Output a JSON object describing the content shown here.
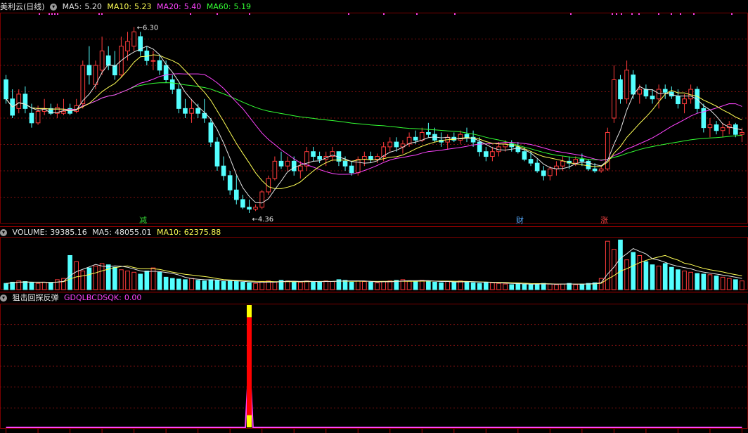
{
  "panel_price": {
    "title": "美利云(日线)",
    "legend": [
      {
        "label": "MA5:",
        "value": "5.20",
        "color": "#e6e6e6"
      },
      {
        "label": "MA10:",
        "value": "5.23",
        "color": "#ffff55"
      },
      {
        "label": "MA20:",
        "value": "5.40",
        "color": "#ff44ff"
      },
      {
        "label": "MA60:",
        "value": "5.19",
        "color": "#33ff33"
      }
    ],
    "high_label": "6.30",
    "low_label": "4.36",
    "markers": [
      {
        "text": "减",
        "color": "#33cc33"
      },
      {
        "text": "财",
        "color": "#55aaff"
      },
      {
        "text": "涨",
        "color": "#ff4444"
      }
    ]
  },
  "panel_volume": {
    "title": "VOLUME:",
    "title_value": "39385.16",
    "legend": [
      {
        "label": "MA5:",
        "value": "48055.01",
        "color": "#e6e6e6"
      },
      {
        "label": "MA10:",
        "value": "62375.88",
        "color": "#ffff55"
      }
    ]
  },
  "panel_indicator": {
    "title": "狙击回探反弹",
    "legend": [
      {
        "label": "GDQLBCDSQK:",
        "value": "0.00",
        "color": "#ff44ff"
      }
    ]
  },
  "colors": {
    "up": "#ff3b3b",
    "down": "#54ffff",
    "ma5": "#e6e6e6",
    "ma10": "#ffff55",
    "ma20": "#ff44ff",
    "ma60": "#33ff33",
    "grid": "#7a1010"
  },
  "chart_data": [
    {
      "type": "candlestick",
      "series": [
        {
          "name": "OHLC",
          "values": [
            [
              5.75,
              5.8,
              5.5,
              5.55
            ],
            [
              5.55,
              5.65,
              5.35,
              5.38
            ],
            [
              5.45,
              5.65,
              5.4,
              5.6
            ],
            [
              5.6,
              5.68,
              5.4,
              5.45
            ],
            [
              5.4,
              5.5,
              5.25,
              5.3
            ],
            [
              5.3,
              5.48,
              5.28,
              5.42
            ],
            [
              5.42,
              5.55,
              5.38,
              5.45
            ],
            [
              5.45,
              5.5,
              5.38,
              5.4
            ],
            [
              5.4,
              5.5,
              5.35,
              5.46
            ],
            [
              5.4,
              5.55,
              5.38,
              5.42
            ],
            [
              5.45,
              5.5,
              5.38,
              5.4
            ],
            [
              5.42,
              5.55,
              5.4,
              5.48
            ],
            [
              5.5,
              5.95,
              5.45,
              5.9
            ],
            [
              5.9,
              6.1,
              5.7,
              5.8
            ],
            [
              5.7,
              5.95,
              5.65,
              5.9
            ],
            [
              5.85,
              6.2,
              5.8,
              6.05
            ],
            [
              6.0,
              6.1,
              5.85,
              5.9
            ],
            [
              5.9,
              6.05,
              5.75,
              5.8
            ],
            [
              5.8,
              6.2,
              5.78,
              6.1
            ],
            [
              6.05,
              6.25,
              5.95,
              6.15
            ],
            [
              6.1,
              6.3,
              6.05,
              6.25
            ],
            [
              6.2,
              6.25,
              6.0,
              6.05
            ],
            [
              6.05,
              6.1,
              5.9,
              5.95
            ],
            [
              5.95,
              6.05,
              5.85,
              5.95
            ],
            [
              5.95,
              6.0,
              5.8,
              5.85
            ],
            [
              5.9,
              5.95,
              5.72,
              5.75
            ],
            [
              5.75,
              5.8,
              5.6,
              5.65
            ],
            [
              5.65,
              5.7,
              5.4,
              5.45
            ],
            [
              5.45,
              5.55,
              5.35,
              5.4
            ],
            [
              5.4,
              5.55,
              5.3,
              5.45
            ],
            [
              5.45,
              5.5,
              5.35,
              5.4
            ],
            [
              5.4,
              5.55,
              5.3,
              5.35
            ],
            [
              5.3,
              5.35,
              5.05,
              5.1
            ],
            [
              5.1,
              5.15,
              4.8,
              4.85
            ],
            [
              4.85,
              4.95,
              4.7,
              4.75
            ],
            [
              4.75,
              4.8,
              4.55,
              4.6
            ],
            [
              4.6,
              4.75,
              4.45,
              4.5
            ],
            [
              4.5,
              4.55,
              4.4,
              4.42
            ],
            [
              4.42,
              4.5,
              4.36,
              4.4
            ],
            [
              4.4,
              4.45,
              4.38,
              4.42
            ],
            [
              4.42,
              4.6,
              4.4,
              4.58
            ],
            [
              4.58,
              4.75,
              4.55,
              4.72
            ],
            [
              4.72,
              4.95,
              4.7,
              4.9
            ],
            [
              4.9,
              5.0,
              4.82,
              4.85
            ],
            [
              4.85,
              4.95,
              4.8,
              4.9
            ],
            [
              4.9,
              4.95,
              4.75,
              4.8
            ],
            [
              4.8,
              4.9,
              4.72,
              4.85
            ],
            [
              4.85,
              5.05,
              4.8,
              5.0
            ],
            [
              5.0,
              5.05,
              4.9,
              4.95
            ],
            [
              4.95,
              5.0,
              4.88,
              4.92
            ],
            [
              4.92,
              5.0,
              4.85,
              4.95
            ],
            [
              4.95,
              5.05,
              4.9,
              5.0
            ],
            [
              5.0,
              5.0,
              4.85,
              4.9
            ],
            [
              4.9,
              4.95,
              4.8,
              4.85
            ],
            [
              4.85,
              4.9,
              4.75,
              4.78
            ],
            [
              4.78,
              4.95,
              4.75,
              4.92
            ],
            [
              4.92,
              5.0,
              4.85,
              4.95
            ],
            [
              4.95,
              5.0,
              4.88,
              4.92
            ],
            [
              4.92,
              4.98,
              4.88,
              4.95
            ],
            [
              4.95,
              5.1,
              4.9,
              5.05
            ],
            [
              5.05,
              5.15,
              5.0,
              5.1
            ],
            [
              5.1,
              5.15,
              5.0,
              5.05
            ],
            [
              5.05,
              5.12,
              4.98,
              5.08
            ],
            [
              5.08,
              5.2,
              5.05,
              5.15
            ],
            [
              5.15,
              5.22,
              5.08,
              5.12
            ],
            [
              5.12,
              5.25,
              5.1,
              5.2
            ],
            [
              5.2,
              5.3,
              5.15,
              5.18
            ],
            [
              5.18,
              5.25,
              5.1,
              5.12
            ],
            [
              5.12,
              5.2,
              5.05,
              5.1
            ],
            [
              5.1,
              5.18,
              5.02,
              5.15
            ],
            [
              5.15,
              5.2,
              5.1,
              5.12
            ],
            [
              5.12,
              5.22,
              5.08,
              5.18
            ],
            [
              5.18,
              5.25,
              5.1,
              5.15
            ],
            [
              5.15,
              5.22,
              5.05,
              5.1
            ],
            [
              5.1,
              5.15,
              4.95,
              5.0
            ],
            [
              5.0,
              5.05,
              4.9,
              4.95
            ],
            [
              4.95,
              5.05,
              4.9,
              5.0
            ],
            [
              5.0,
              5.1,
              4.95,
              5.05
            ],
            [
              5.05,
              5.12,
              5.0,
              5.08
            ],
            [
              5.08,
              5.12,
              5.0,
              5.05
            ],
            [
              5.05,
              5.1,
              4.98,
              5.0
            ],
            [
              5.0,
              5.05,
              4.9,
              4.92
            ],
            [
              4.92,
              5.0,
              4.85,
              4.88
            ],
            [
              4.88,
              4.92,
              4.78,
              4.8
            ],
            [
              4.8,
              4.85,
              4.7,
              4.75
            ],
            [
              4.75,
              4.85,
              4.7,
              4.82
            ],
            [
              4.82,
              4.9,
              4.75,
              4.85
            ],
            [
              4.85,
              4.95,
              4.8,
              4.9
            ],
            [
              4.9,
              4.95,
              4.82,
              4.88
            ],
            [
              4.88,
              4.95,
              4.85,
              4.92
            ],
            [
              4.92,
              4.98,
              4.85,
              4.9
            ],
            [
              4.9,
              4.92,
              4.8,
              4.82
            ],
            [
              4.82,
              4.88,
              4.78,
              4.8
            ],
            [
              4.8,
              4.85,
              4.78,
              4.82
            ],
            [
              4.82,
              5.25,
              4.8,
              5.2
            ],
            [
              5.35,
              5.9,
              5.3,
              5.75
            ],
            [
              5.75,
              5.8,
              5.5,
              5.55
            ],
            [
              5.55,
              5.95,
              5.5,
              5.85
            ],
            [
              5.8,
              5.85,
              5.55,
              5.6
            ],
            [
              5.6,
              5.7,
              5.5,
              5.65
            ],
            [
              5.65,
              5.7,
              5.55,
              5.58
            ],
            [
              5.58,
              5.65,
              5.5,
              5.55
            ],
            [
              5.55,
              5.7,
              5.45,
              5.65
            ],
            [
              5.65,
              5.7,
              5.55,
              5.62
            ],
            [
              5.62,
              5.68,
              5.55,
              5.58
            ],
            [
              5.58,
              5.65,
              5.45,
              5.5
            ],
            [
              5.5,
              5.6,
              5.4,
              5.55
            ],
            [
              5.55,
              5.7,
              5.5,
              5.65
            ],
            [
              5.65,
              5.68,
              5.4,
              5.45
            ],
            [
              5.45,
              5.5,
              5.2,
              5.25
            ],
            [
              5.25,
              5.35,
              5.15,
              5.28
            ],
            [
              5.28,
              5.32,
              5.18,
              5.22
            ],
            [
              5.22,
              5.3,
              5.15,
              5.25
            ],
            [
              5.25,
              5.32,
              5.18,
              5.28
            ],
            [
              5.28,
              5.3,
              5.15,
              5.18
            ],
            [
              5.18,
              5.25,
              5.1,
              5.2
            ]
          ]
        }
      ],
      "ylim": [
        4.25,
        6.45
      ]
    },
    {
      "type": "bar",
      "series": [
        {
          "name": "VOLUME",
          "values": [
            10,
            12,
            14,
            13,
            11,
            10,
            12,
            11,
            16,
            18,
            55,
            45,
            30,
            35,
            38,
            42,
            40,
            36,
            32,
            30,
            28,
            25,
            30,
            35,
            28,
            20,
            18,
            17,
            16,
            18,
            15,
            14,
            16,
            15,
            13,
            14,
            13,
            12,
            11,
            10,
            13,
            14,
            12,
            15,
            14,
            13,
            12,
            14,
            13,
            12,
            14,
            13,
            16,
            15,
            12,
            14,
            13,
            12,
            11,
            13,
            14,
            15,
            16,
            14,
            13,
            15,
            14,
            12,
            11,
            13,
            12,
            14,
            13,
            11,
            10,
            12,
            11,
            10,
            9,
            8,
            10,
            9,
            8,
            9,
            10,
            9,
            8,
            9,
            10,
            8,
            9,
            10,
            11,
            18,
            78,
            65,
            80,
            48,
            60,
            55,
            45,
            40,
            38,
            42,
            36,
            32,
            30,
            28,
            26,
            25,
            24,
            22,
            20,
            18,
            16,
            14
          ]
        }
      ],
      "ylim": [
        0,
        85
      ]
    },
    {
      "type": "line",
      "series": [
        {
          "name": "GDQLBCDSQK",
          "values": [
            0,
            0,
            0,
            0,
            0,
            0,
            0,
            0,
            0,
            0,
            0,
            0,
            0,
            0,
            0,
            0,
            0,
            0,
            0,
            0,
            0,
            0,
            0,
            0,
            0,
            0,
            0,
            0,
            0,
            0,
            0,
            0,
            0,
            0,
            0,
            0,
            0,
            0,
            0,
            0,
            0,
            0,
            0,
            0,
            0,
            0,
            0,
            0,
            0,
            0,
            0,
            0,
            0,
            0,
            0,
            0,
            0,
            0,
            0,
            0,
            0,
            0,
            0,
            0,
            0,
            0,
            0,
            0,
            0,
            0,
            0,
            0,
            0,
            0,
            0,
            0,
            0,
            0,
            0,
            0,
            0,
            0,
            0,
            0,
            0,
            0,
            0,
            0,
            0,
            0,
            0,
            0,
            0,
            0,
            0,
            0,
            0,
            0,
            0,
            0,
            0,
            0,
            0,
            0,
            0,
            0,
            0,
            0,
            0,
            0,
            0,
            0,
            0,
            0,
            0,
            0,
            0,
            0,
            0,
            0
          ]
        }
      ],
      "signals": [
        {
          "index": 38,
          "value": 100
        }
      ],
      "ylim": [
        0,
        100
      ]
    }
  ]
}
